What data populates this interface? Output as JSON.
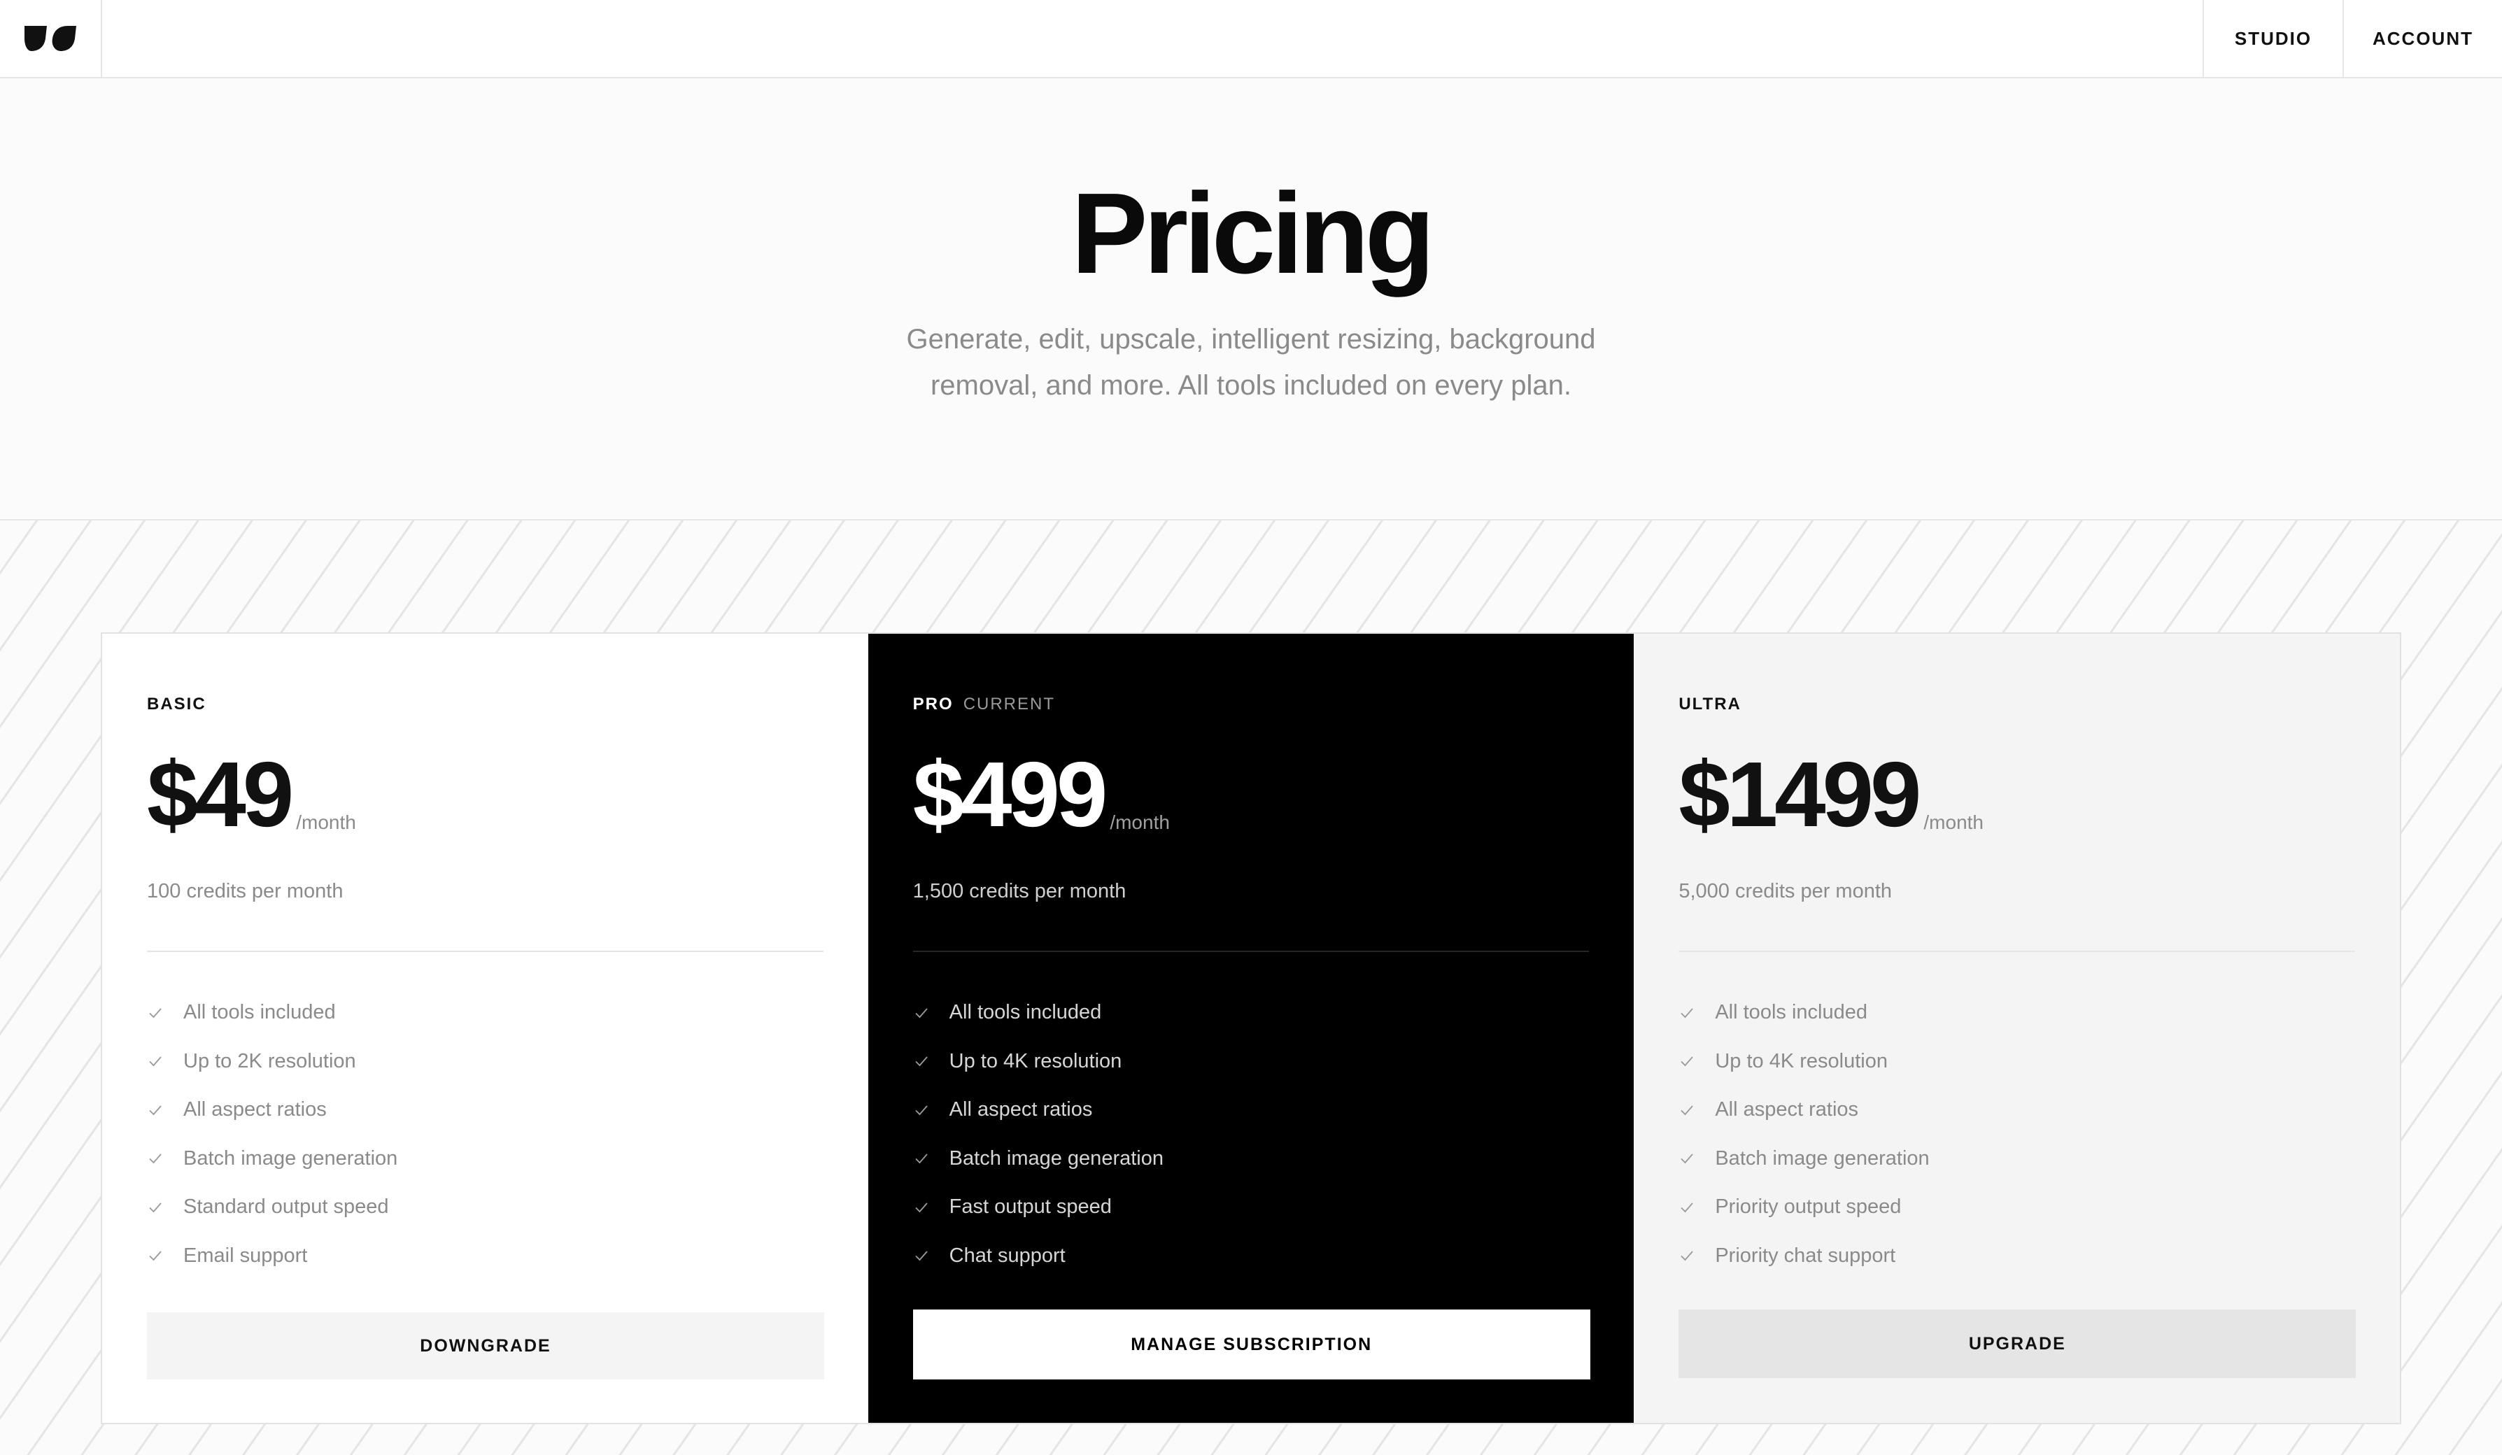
{
  "header": {
    "logo_icon": "brand-logo-icon",
    "nav": [
      {
        "label": "STUDIO"
      },
      {
        "label": "ACCOUNT"
      }
    ]
  },
  "hero": {
    "title": "Pricing",
    "subtitle": "Generate, edit, upscale, intelligent resizing, background removal, and more. All tools included on every plan."
  },
  "plans": [
    {
      "name": "BASIC",
      "badge": "",
      "price": "$49",
      "period": "/month",
      "credits": "100 credits per month",
      "features": [
        "All tools included",
        "Up to 2K resolution",
        "All aspect ratios",
        "Batch image generation",
        "Standard output speed",
        "Email support"
      ],
      "cta": "DOWNGRADE"
    },
    {
      "name": "PRO",
      "badge": "CURRENT",
      "price": "$499",
      "period": "/month",
      "credits": "1,500 credits per month",
      "features": [
        "All tools included",
        "Up to 4K resolution",
        "All aspect ratios",
        "Batch image generation",
        "Fast output speed",
        "Chat support"
      ],
      "cta": "MANAGE SUBSCRIPTION"
    },
    {
      "name": "ULTRA",
      "badge": "",
      "price": "$1499",
      "period": "/month",
      "credits": "5,000 credits per month",
      "features": [
        "All tools included",
        "Up to 4K resolution",
        "All aspect ratios",
        "Batch image generation",
        "Priority output speed",
        "Priority chat support"
      ],
      "cta": "UPGRADE"
    }
  ],
  "colors": {
    "pro_card_bg": "#000000",
    "basic_card_bg": "#ffffff",
    "ultra_card_bg": "#f4f4f4",
    "muted_text": "#8a8a8a"
  },
  "icons": {
    "feature_check": "check-icon"
  }
}
